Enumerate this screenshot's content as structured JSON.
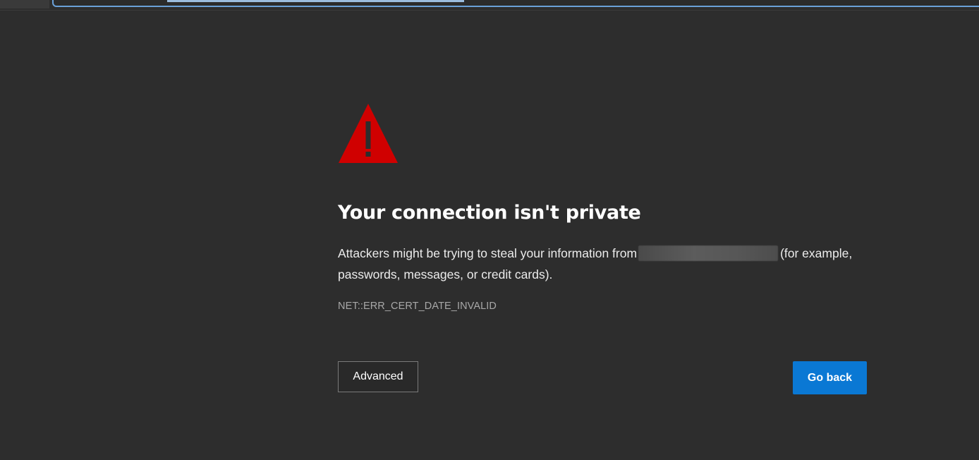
{
  "browser": {
    "address_bar": {
      "text": ""
    }
  },
  "error_page": {
    "icon": "warning-triangle-icon",
    "icon_color": "#d00000",
    "title": "Your connection isn't private",
    "description_before": "Attackers might be trying to steal your information from",
    "description_after": "(for example, passwords, messages, or credit cards).",
    "error_code": "NET::ERR_CERT_DATE_INVALID",
    "advanced_label": "Advanced",
    "go_back_label": "Go back",
    "go_back_color": "#0a78d4"
  }
}
